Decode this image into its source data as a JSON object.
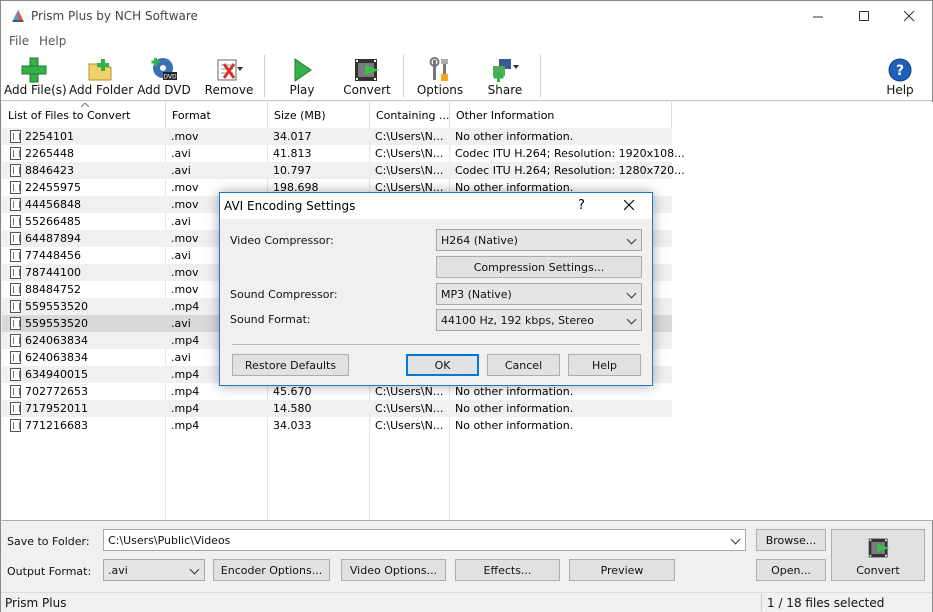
{
  "window": {
    "title": "Prism Plus by NCH Software"
  },
  "menu": [
    "File",
    "Help"
  ],
  "toolbar": {
    "add_files": "Add File(s)",
    "add_folder": "Add Folder",
    "add_dvd": "Add DVD",
    "remove": "Remove",
    "play": "Play",
    "convert": "Convert",
    "options": "Options",
    "share": "Share",
    "help": "Help"
  },
  "table": {
    "columns": [
      "List of Files to Convert",
      "Format",
      "Size (MB)",
      "Containing ...",
      "Other Information"
    ],
    "rows": [
      {
        "name": "2254101",
        "format": ".mov",
        "size": "34.017",
        "path": "C:\\Users\\N...",
        "info": "No other information."
      },
      {
        "name": "2265448",
        "format": ".avi",
        "size": "41.813",
        "path": "C:\\Users\\N...",
        "info": "Codec ITU H.264; Resolution: 1920x108..."
      },
      {
        "name": "8846423",
        "format": ".avi",
        "size": "10.797",
        "path": "C:\\Users\\N...",
        "info": "Codec ITU H.264; Resolution: 1280x720..."
      },
      {
        "name": "22455975",
        "format": ".mov",
        "size": "198.698",
        "path": "C:\\Users\\N...",
        "info": "No other information."
      },
      {
        "name": "44456848",
        "format": ".mov",
        "size": "",
        "path": "",
        "info": ""
      },
      {
        "name": "55266485",
        "format": ".avi",
        "size": "",
        "path": "",
        "info": ""
      },
      {
        "name": "64487894",
        "format": ".mov",
        "size": "",
        "path": "",
        "info": ""
      },
      {
        "name": "77448456",
        "format": ".avi",
        "size": "",
        "path": "",
        "info": ""
      },
      {
        "name": "78744100",
        "format": ".mov",
        "size": "",
        "path": "",
        "info": ""
      },
      {
        "name": "88484752",
        "format": ".mov",
        "size": "",
        "path": "",
        "info": ""
      },
      {
        "name": "559553520",
        "format": ".mp4",
        "size": "",
        "path": "",
        "info": ""
      },
      {
        "name": "559553520",
        "format": ".avi",
        "size": "",
        "path": "",
        "info": ""
      },
      {
        "name": "624063834",
        "format": ".mp4",
        "size": "",
        "path": "",
        "info": ""
      },
      {
        "name": "624063834",
        "format": ".avi",
        "size": "",
        "path": "",
        "info": ""
      },
      {
        "name": "634940015",
        "format": ".mp4",
        "size": "",
        "path": "",
        "info": ""
      },
      {
        "name": "702772653",
        "format": ".mp4",
        "size": "45.670",
        "path": "C:\\Users\\N...",
        "info": "No other information."
      },
      {
        "name": "717952011",
        "format": ".mp4",
        "size": "14.580",
        "path": "C:\\Users\\N...",
        "info": "No other information."
      },
      {
        "name": "771216683",
        "format": ".mp4",
        "size": "34.033",
        "path": "C:\\Users\\N...",
        "info": "No other information."
      }
    ]
  },
  "bottom": {
    "save_label": "Save to Folder:",
    "save_value": "C:\\Users\\Public\\Videos",
    "browse": "Browse...",
    "output_label": "Output Format:",
    "output_value": ".avi",
    "encoder_options": "Encoder Options...",
    "video_options": "Video Options...",
    "effects": "Effects...",
    "preview": "Preview",
    "open": "Open...",
    "convert": "Convert"
  },
  "status": {
    "left": "Prism Plus",
    "right": "1 / 18 files selected"
  },
  "dialog": {
    "title": "AVI Encoding Settings",
    "help_glyph": "?",
    "video_compressor_label": "Video Compressor:",
    "video_compressor_value": "H264 (Native)",
    "compression_settings": "Compression Settings...",
    "sound_compressor_label": "Sound Compressor:",
    "sound_compressor_value": "MP3 (Native)",
    "sound_format_label": "Sound Format:",
    "sound_format_value": "44100 Hz, 192 kbps, Stereo",
    "restore_defaults": "Restore Defaults",
    "ok": "OK",
    "cancel": "Cancel",
    "help": "Help"
  }
}
